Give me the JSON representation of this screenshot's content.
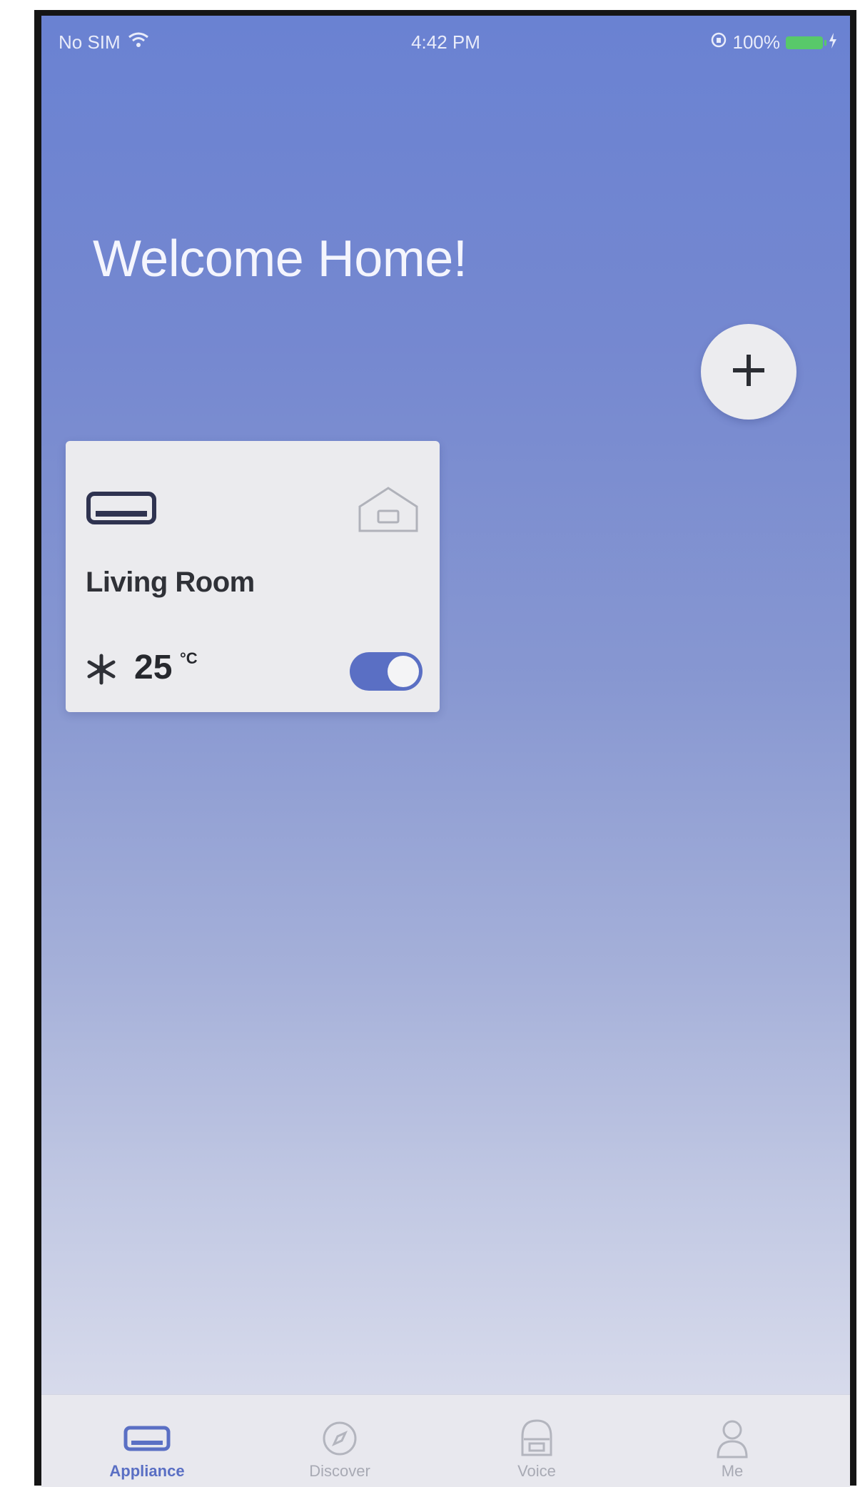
{
  "status_bar": {
    "carrier": "No SIM",
    "time": "4:42 PM",
    "battery": "100%"
  },
  "header": {
    "title": "Welcome Home!"
  },
  "device_card": {
    "name": "Living Room",
    "temperature": "25",
    "unit": "°C",
    "power_on": true
  },
  "tabs": [
    {
      "label": "Appliance",
      "icon": "ac-unit-icon",
      "active": true
    },
    {
      "label": "Discover",
      "icon": "compass-icon",
      "active": false
    },
    {
      "label": "Voice",
      "icon": "speaker-icon",
      "active": false
    },
    {
      "label": "Me",
      "icon": "user-icon",
      "active": false
    }
  ],
  "colors": {
    "accent": "#5a6fc4",
    "background_top": "#6a82d2",
    "background_bottom": "#e2e4ef",
    "card": "#ebebee"
  }
}
